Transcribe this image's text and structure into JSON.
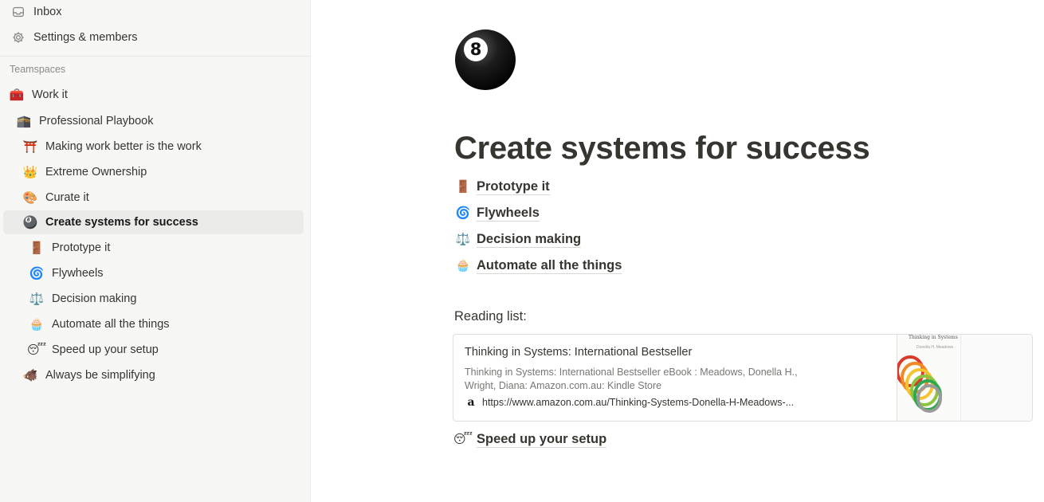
{
  "sidebar": {
    "top_items": [
      {
        "label": "Inbox",
        "icon": "inbox-icon"
      },
      {
        "label": "Settings & members",
        "icon": "gear-icon"
      }
    ],
    "section_label": "Teamspaces",
    "tree": [
      {
        "label": "Work it",
        "emoji": "🧰"
      },
      {
        "label": "Professional Playbook",
        "emoji": "🕋"
      },
      {
        "label": "Making work better is the work",
        "emoji": "⛩️"
      },
      {
        "label": "Extreme Ownership",
        "emoji": "👑"
      },
      {
        "label": "Curate it",
        "emoji": "🎨"
      },
      {
        "label": "Create systems for success",
        "emoji": "🎱",
        "active": true
      },
      {
        "label": "Prototype it",
        "emoji": "🚪"
      },
      {
        "label": "Flywheels",
        "emoji": "🌀"
      },
      {
        "label": "Decision making",
        "emoji": "⚖️"
      },
      {
        "label": "Automate all the things",
        "emoji": "🧁"
      },
      {
        "label": "Speed up your setup",
        "emoji": "😴"
      },
      {
        "label": "Always be simplifying",
        "emoji": "🐗"
      }
    ]
  },
  "page": {
    "icon": "eight-ball",
    "title": "Create systems for success",
    "subpages": [
      {
        "label": "Prototype it",
        "emoji": "🚪"
      },
      {
        "label": "Flywheels",
        "emoji": "🌀"
      },
      {
        "label": "Decision making",
        "emoji": "⚖️"
      },
      {
        "label": "Automate all the things",
        "emoji": "🧁"
      }
    ],
    "reading_label": "Reading list:",
    "bookmark": {
      "title": "Thinking in Systems: International Bestseller",
      "description": "Thinking in Systems: International Bestseller eBook : Meadows, Donella H., Wright, Diana: Amazon.com.au: Kindle Store",
      "favicon": "a",
      "url": "https://www.amazon.com.au/Thinking-Systems-Donella-H-Meadows-...",
      "thumb_title": "Thinking in Systems",
      "thumb_author": "Donella H. Meadows"
    },
    "last_link": {
      "label": "Speed up your setup",
      "emoji": "😴"
    }
  }
}
